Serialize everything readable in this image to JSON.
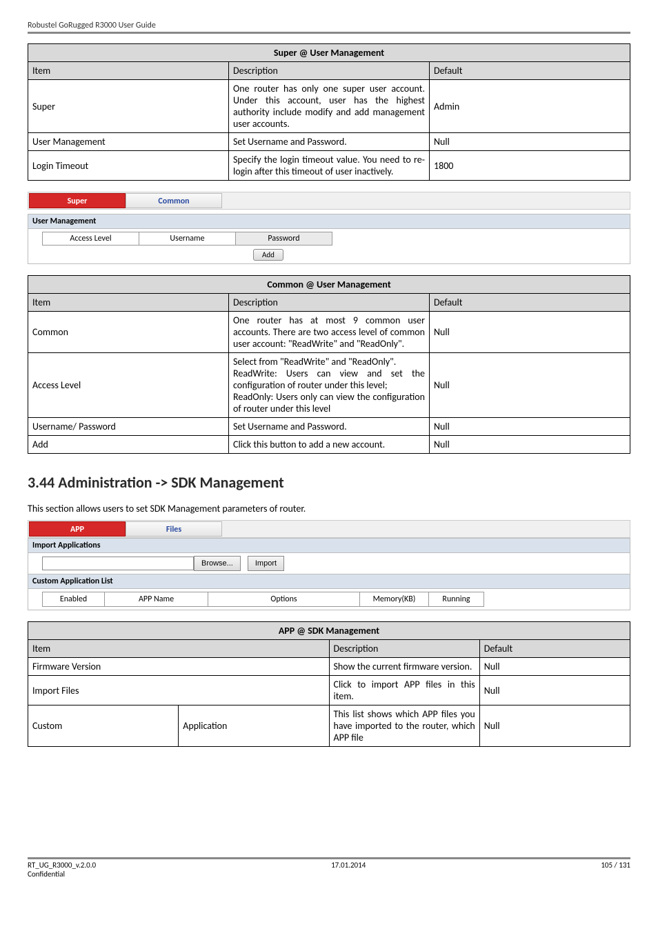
{
  "page_header": "Robustel GoRugged R3000 User Guide",
  "table1": {
    "title": "Super @ User Management",
    "head_item": "Item",
    "head_desc": "Description",
    "head_default": "Default",
    "rows": [
      {
        "item": "Super",
        "desc": "One router has only one super user account. Under this account, user has the highest authority include modify and add management user accounts.",
        "def": "Admin"
      },
      {
        "item": "User Management",
        "desc": "Set Username and Password.",
        "def": "Null"
      },
      {
        "item": "Login Timeout",
        "desc": "Specify the login timeout value. You need to re-login after this timeout of user inactively.",
        "def": "1800"
      }
    ]
  },
  "tabs1": {
    "active": "Super",
    "inactive": "Common"
  },
  "um_panel": {
    "title": "User Management",
    "col1": "Access Level",
    "col2": "Username",
    "col3": "Password",
    "add": "Add"
  },
  "table2": {
    "title": "Common @ User Management",
    "head_item": "Item",
    "head_desc": "Description",
    "head_default": "Default",
    "rows": [
      {
        "item": "Common",
        "desc": "One router has at most 9 common user accounts. There are two access level of common user account: \"ReadWrite\" and \"ReadOnly\".",
        "def": "Null"
      },
      {
        "item": "Access Level",
        "desc": "Select from \"ReadWrite\" and \"ReadOnly\".\nReadWrite: Users can view and set the configuration of router under this level;\nReadOnly: Users only can view the configuration of router under this level",
        "def": "Null"
      },
      {
        "item": "Username/ Password",
        "desc": "Set Username and Password.",
        "def": "Null"
      },
      {
        "item": "Add",
        "desc": "Click this button to add a new account.",
        "def": "Null"
      }
    ]
  },
  "heading": "3.44  Administration -> SDK Management",
  "lead": "This section allows users to set SDK Management parameters of router.",
  "tabs2": {
    "active": "APP",
    "inactive": "Files"
  },
  "import_panel": {
    "title": "Import Applications",
    "browse": "Browse...",
    "import": "Import"
  },
  "cal_panel": {
    "title": "Custom Application List",
    "cols": [
      "Enabled",
      "APP Name",
      "Options",
      "Memory(KB)",
      "Running"
    ]
  },
  "table3": {
    "title": "APP @ SDK Management",
    "head_item": "Item",
    "head_desc": "Description",
    "head_default": "Default",
    "rows": [
      {
        "item": "Firmware Version",
        "desc": "Show the current firmware version.",
        "def": "Null"
      },
      {
        "item": "Import Files",
        "desc": "Click to import APP files in this item.",
        "def": "Null"
      }
    ],
    "split_row": {
      "item1": "Custom",
      "item2": "Application",
      "desc": "This list shows which APP files you have imported to the router, which APP file",
      "def": "Null"
    }
  },
  "footer": {
    "left": "RT_UG_R3000_v.2.0.0",
    "left2": "Confidential",
    "center": "17.01.2014",
    "right": "105 / 131"
  }
}
